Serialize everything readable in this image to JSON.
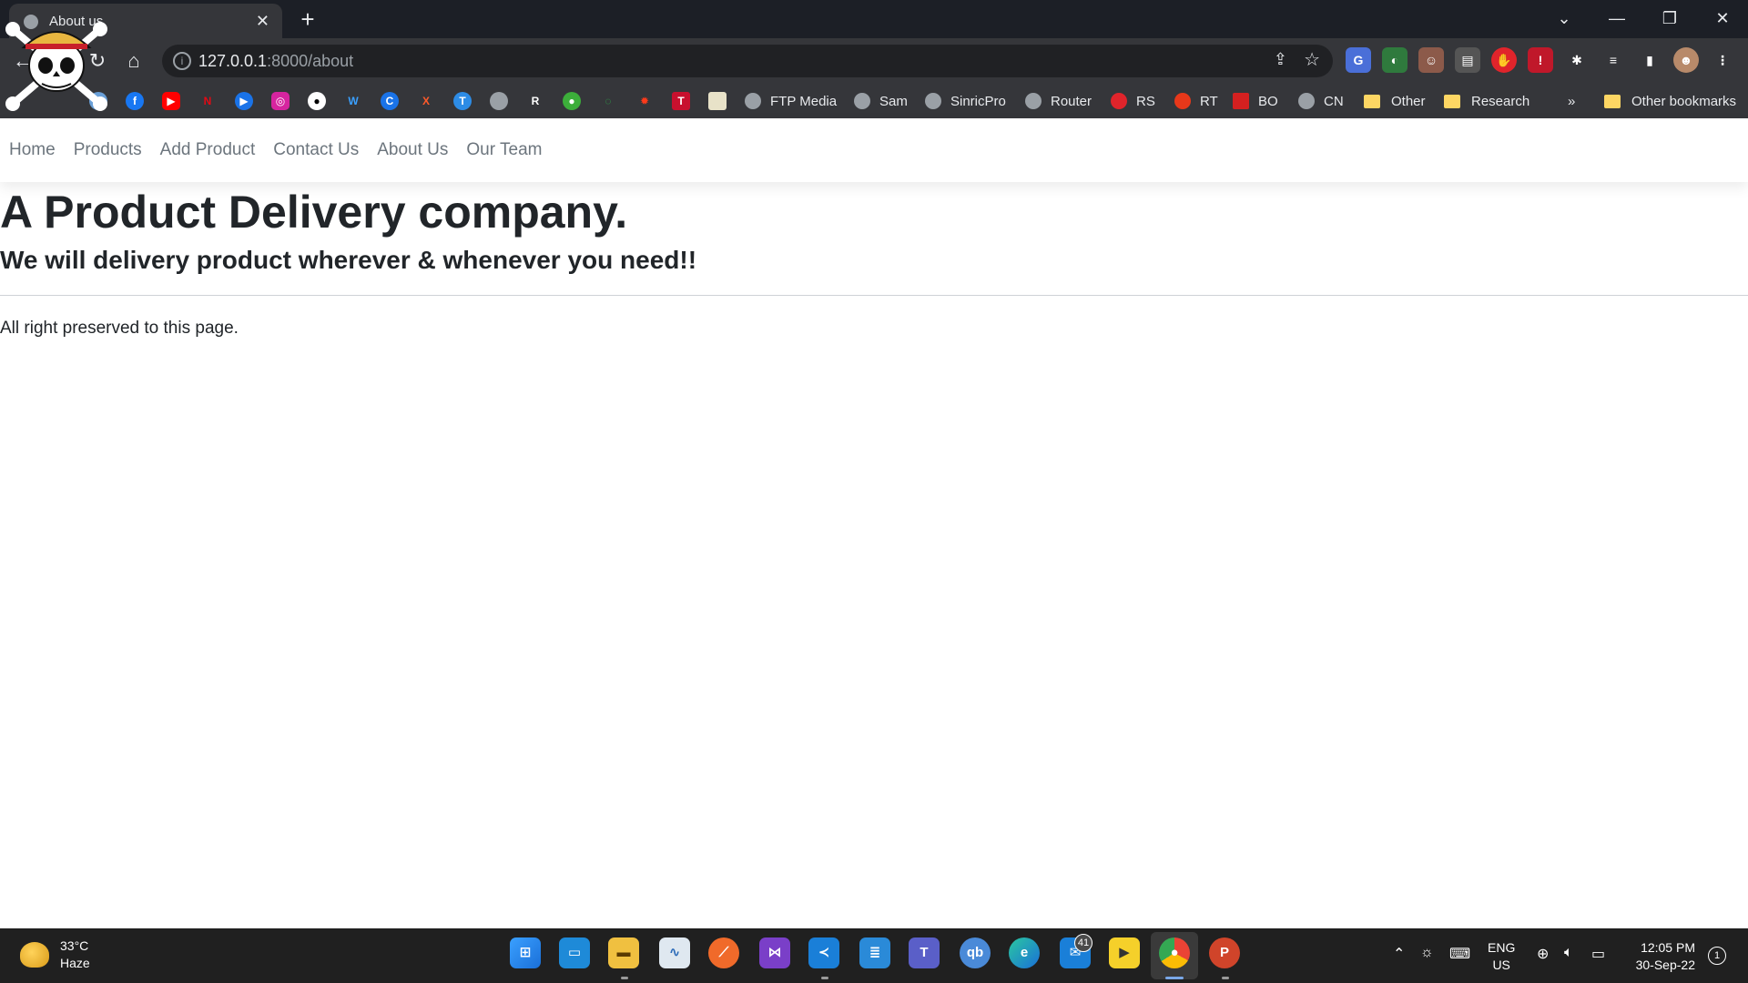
{
  "browser": {
    "tab_title": "About us",
    "url_host": "127.0.0.1",
    "url_rest": ":8000/about",
    "bookmarks": [
      {
        "label": "FTP Media"
      },
      {
        "label": "Sam"
      },
      {
        "label": "SinricPro"
      },
      {
        "label": "Router"
      },
      {
        "label": "RS"
      },
      {
        "label": "RT"
      },
      {
        "label": "BO"
      },
      {
        "label": "CN"
      },
      {
        "label": "Other"
      },
      {
        "label": "Research"
      }
    ],
    "overflow": "»",
    "other_bookmarks": "Other bookmarks"
  },
  "nav": {
    "links": [
      "Home",
      "Products",
      "Add Product",
      "Contact Us",
      "About Us",
      "Our Team"
    ]
  },
  "page": {
    "title": "A Product Delivery company.",
    "subtitle": "We will delivery product wherever & whenever you need!!",
    "footer": "All right preserved to this page."
  },
  "taskbar": {
    "weather_temp": "33°C",
    "weather_desc": "Haze",
    "teams_badge": "41",
    "lang": "ENG",
    "region": "US",
    "time": "12:05 PM",
    "date": "30-Sep-22",
    "notif_count": "1"
  }
}
